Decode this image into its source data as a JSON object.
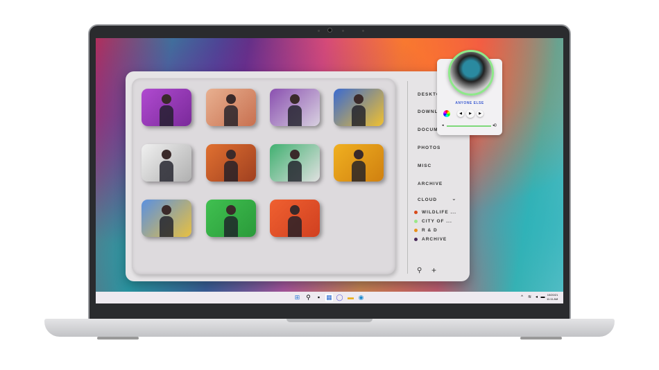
{
  "sidebar": {
    "items": [
      "DESKTOP",
      "DOWNLOADS",
      "DOCUMENTS",
      "PHOTOS",
      "MISC",
      "ARCHIVE"
    ],
    "cloud_label": "CLOUD",
    "cloud_items": [
      {
        "label": "WILDLIFE ...",
        "color": "#d84a1a"
      },
      {
        "label": "CITY OF ...",
        "color": "#9ae88a"
      },
      {
        "label": "R & D",
        "color": "#e8901a"
      },
      {
        "label": "ARCHIVE",
        "color": "#4a2a5a"
      }
    ]
  },
  "music": {
    "song": "ANYONE ELSE"
  },
  "taskbar": {
    "date": "10/20/21",
    "time": "11:11 AM"
  },
  "photos": [
    {
      "c1": "#b04ad0",
      "c2": "#7a2a9a"
    },
    {
      "c1": "#e8b090",
      "c2": "#c87050"
    },
    {
      "c1": "#8a50b0",
      "c2": "#d8d0e0"
    },
    {
      "c1": "#3a6ad0",
      "c2": "#f0c030"
    },
    {
      "c1": "#f0f0f0",
      "c2": "#b0b0b0"
    },
    {
      "c1": "#e07030",
      "c2": "#a04020"
    },
    {
      "c1": "#40b070",
      "c2": "#e0e0e0"
    },
    {
      "c1": "#f0b020",
      "c2": "#d08010"
    },
    {
      "c1": "#5a90e0",
      "c2": "#e8c040"
    },
    {
      "c1": "#40c050",
      "c2": "#2a9a3a"
    },
    {
      "c1": "#f06030",
      "c2": "#d04020"
    }
  ]
}
